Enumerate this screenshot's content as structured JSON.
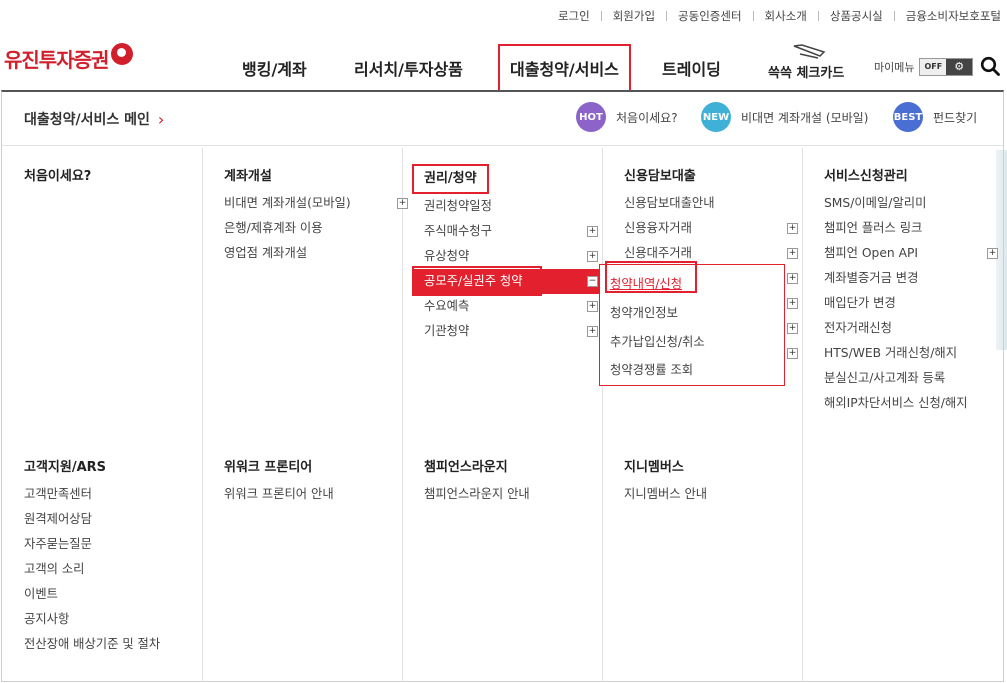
{
  "util_links": [
    "로그인",
    "회원가입",
    "공동인증센터",
    "회사소개",
    "상품공시실",
    "금융소비자보호포털"
  ],
  "logo_text": "유진투자증권",
  "gnb": [
    "뱅킹/계좌",
    "리서치/투자상품",
    "대출청약/서비스",
    "트레이딩"
  ],
  "card_menu": "쓱쓱 체크카드",
  "mymenu": {
    "label": "마이메뉴",
    "toggle": "OFF"
  },
  "mega": {
    "breadcrumb": "대출청약/서비스 메인",
    "quick": [
      {
        "badge": "HOT",
        "label": "처음이세요?",
        "color": "#8b63c9"
      },
      {
        "badge": "NEW",
        "label": "비대면 계좌개설 (모바일)",
        "color": "#3fb0d6"
      },
      {
        "badge": "BEST",
        "label": "펀드찾기",
        "color": "#4a6fd2"
      }
    ],
    "columns_top": [
      {
        "title": "처음이세요?",
        "items": []
      },
      {
        "title": "계좌개설",
        "items": [
          "비대면 계좌개설(모바일)",
          "은행/제휴계좌 이용",
          "영업점 계좌개설"
        ]
      },
      {
        "title": "권리/청약",
        "items": [
          "권리청약일정",
          "주식매수청구",
          "유상청약",
          "공모주/실권주 청약",
          "수요예측",
          "기관청약"
        ]
      },
      {
        "title": "신용담보대출",
        "items": [
          "신용담보대출안내",
          "신용융자거래",
          "신용대주거래"
        ]
      },
      {
        "title": "서비스신청관리",
        "items": [
          "SMS/이메일/알리미",
          "챔피언 플러스 링크",
          "챔피언 Open API",
          "계좌별증거금 변경",
          "매입단가 변경",
          "전자거래신청",
          "HTS/WEB 거래신청/해지",
          "분실신고/사고계좌 등록",
          "해외IP차단서비스 신청/해지"
        ]
      }
    ],
    "columns_bottom": [
      {
        "title": "고객지원/ARS",
        "items": [
          "고객만족센터",
          "원격제어상담",
          "자주묻는질문",
          "고객의 소리",
          "이벤트",
          "공지사항",
          "전산장애 배상기준 및 절차"
        ]
      },
      {
        "title": "위워크 프론티어",
        "items": [
          "위워크 프론티어 안내"
        ]
      },
      {
        "title": "챔피언스라운지",
        "items": [
          "챔피언스라운지 안내"
        ]
      },
      {
        "title": "지니멤버스",
        "items": [
          "지니멤버스 안내"
        ]
      }
    ],
    "submenu": [
      "청약내역/신청",
      "청약개인정보",
      "추가납입신청/취소",
      "청약경쟁률 조회"
    ]
  }
}
